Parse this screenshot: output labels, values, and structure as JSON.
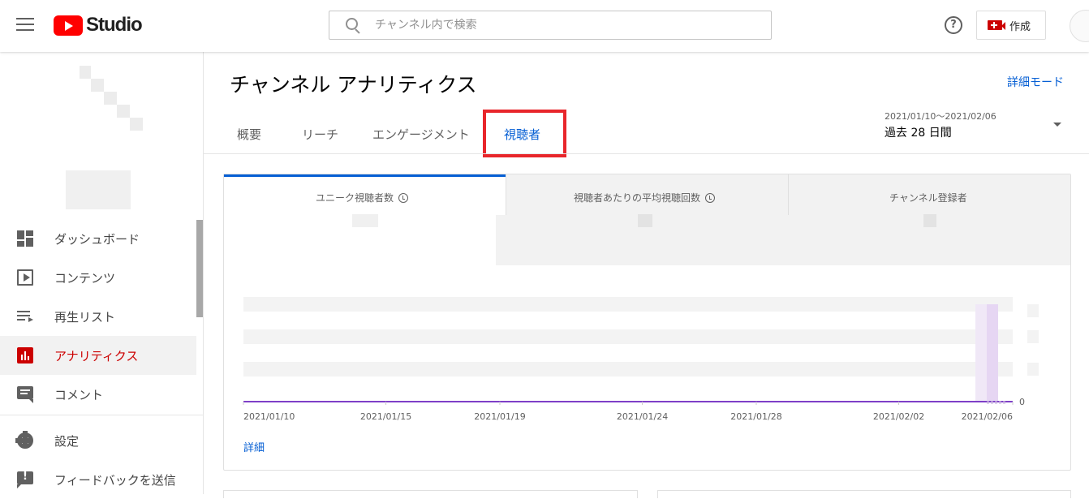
{
  "topbar": {
    "logo_text": "Studio",
    "search_placeholder": "チャンネル内で検索",
    "help_icon": "?",
    "create_label": "作成"
  },
  "sidebar": {
    "items": [
      {
        "label": "ダッシュボード",
        "icon": "dashboard-icon"
      },
      {
        "label": "コンテンツ",
        "icon": "content-icon"
      },
      {
        "label": "再生リスト",
        "icon": "playlist-icon"
      },
      {
        "label": "アナリティクス",
        "icon": "analytics-icon",
        "active": true
      },
      {
        "label": "コメント",
        "icon": "comment-icon"
      },
      {
        "label": "設定",
        "icon": "gear-icon"
      },
      {
        "label": "フィードバックを送信",
        "icon": "feedback-icon"
      }
    ]
  },
  "main": {
    "title": "チャンネル アナリティクス",
    "detail_mode": "詳細モード",
    "tabs": [
      "概要",
      "リーチ",
      "エンゲージメント",
      "視聴者"
    ],
    "selected_tab": "視聴者",
    "date_range": "2021/01/10〜2021/02/06",
    "date_label": "過去 28 日間",
    "metrics": [
      "ユニーク視聴者数",
      "視聴者あたりの平均視聴回数",
      "チャンネル登録者"
    ],
    "detail_link": "詳細",
    "colors": {
      "accent": "#065fd4",
      "active_nav": "#cc0000",
      "line": "#7e3fc7",
      "highlight": "#e8262b"
    }
  },
  "chart_data": {
    "type": "line",
    "x": [
      "2021/01/10",
      "2021/01/15",
      "2021/01/19",
      "2021/01/24",
      "2021/01/28",
      "2021/02/02",
      "2021/02/06"
    ],
    "y_tick_labels": [
      "0"
    ],
    "series": [
      {
        "values": [
          0,
          0,
          0,
          0,
          0,
          0,
          0
        ]
      }
    ],
    "grid": true
  }
}
